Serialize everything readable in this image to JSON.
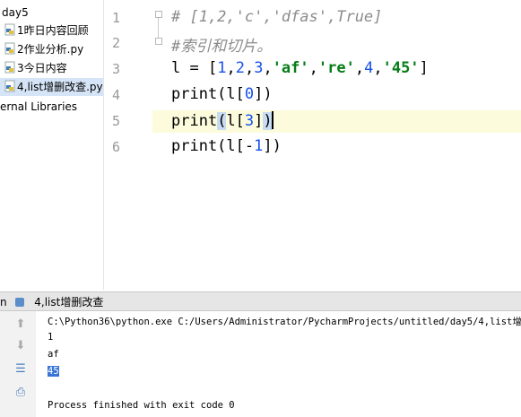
{
  "project_tree": {
    "root": "day5",
    "files": [
      {
        "name": "1昨日内容回顾",
        "selected": false
      },
      {
        "name": "2作业分析.py",
        "selected": false
      },
      {
        "name": "3今日内容",
        "selected": false
      },
      {
        "name": "4,list增删改查.py",
        "selected": true
      }
    ],
    "external": "ernal Libraries"
  },
  "editor": {
    "line_numbers": [
      "1",
      "2",
      "3",
      "4",
      "5",
      "6"
    ],
    "lines": [
      {
        "parts": [
          {
            "t": "# [1,2,'c','dfas',True]",
            "c": "comment"
          }
        ]
      },
      {
        "parts": [
          {
            "t": "#索引和切片。",
            "c": "comment"
          }
        ]
      },
      {
        "parts": [
          {
            "t": "l = [",
            "c": ""
          },
          {
            "t": "1",
            "c": "num"
          },
          {
            "t": ",",
            "c": ""
          },
          {
            "t": "2",
            "c": "num"
          },
          {
            "t": ",",
            "c": ""
          },
          {
            "t": "3",
            "c": "num"
          },
          {
            "t": ",",
            "c": ""
          },
          {
            "t": "'af'",
            "c": "str"
          },
          {
            "t": ",",
            "c": ""
          },
          {
            "t": "'re'",
            "c": "str"
          },
          {
            "t": ",",
            "c": ""
          },
          {
            "t": "4",
            "c": "num"
          },
          {
            "t": ",",
            "c": ""
          },
          {
            "t": "'45'",
            "c": "str"
          },
          {
            "t": "]",
            "c": ""
          }
        ]
      },
      {
        "parts": [
          {
            "t": "print(l[",
            "c": ""
          },
          {
            "t": "0",
            "c": "num"
          },
          {
            "t": "])",
            "c": ""
          }
        ]
      },
      {
        "parts": [
          {
            "t": "print",
            "c": ""
          },
          {
            "t": "(",
            "c": "paren"
          },
          {
            "t": "l[",
            "c": ""
          },
          {
            "t": "3",
            "c": "num"
          },
          {
            "t": "]",
            "c": ""
          },
          {
            "t": ")",
            "c": "paren"
          },
          {
            "t": "",
            "c": "caret"
          }
        ]
      },
      {
        "parts": [
          {
            "t": "print(l[-",
            "c": ""
          },
          {
            "t": "1",
            "c": "num"
          },
          {
            "t": "])",
            "c": ""
          }
        ]
      }
    ]
  },
  "run_panel": {
    "tab_prefix": "n",
    "tab_label": "4,list增删改查",
    "console_lines": [
      {
        "text": "C:\\Python36\\python.exe C:/Users/Administrator/PycharmProjects/untitled/day5/4,list增删改",
        "sel": false
      },
      {
        "text": "1",
        "sel": false
      },
      {
        "text": "af",
        "sel": false
      },
      {
        "text": "45",
        "sel": true
      },
      {
        "text": "",
        "sel": false
      },
      {
        "text": "Process finished with exit code 0",
        "sel": false
      }
    ],
    "toolbar": [
      "arrow-up-icon",
      "arrow-down-icon",
      "soft-wrap-icon",
      "print-icon"
    ]
  }
}
